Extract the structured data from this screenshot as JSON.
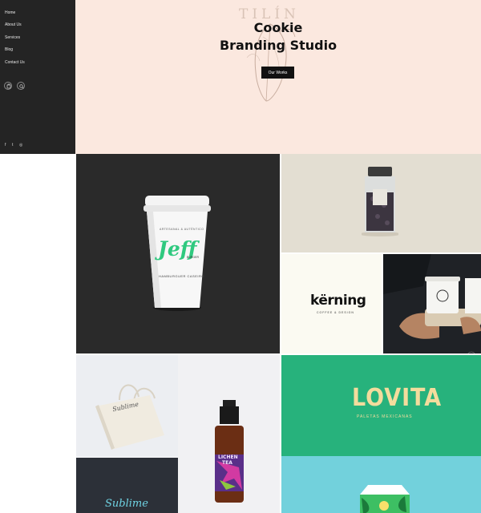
{
  "sidebar": {
    "nav": [
      {
        "label": "Home"
      },
      {
        "label": "About Us"
      },
      {
        "label": "Services"
      },
      {
        "label": "Blog"
      },
      {
        "label": "Contact Us"
      }
    ],
    "icons": [
      "cart-icon",
      "search-icon"
    ],
    "social": [
      {
        "icon": "facebook-icon",
        "glyph": "f"
      },
      {
        "icon": "twitter-icon",
        "glyph": "t"
      },
      {
        "icon": "instagram-icon",
        "glyph": "◎"
      }
    ]
  },
  "hero": {
    "watermark": "TILÍN",
    "title_line1": "Cookie",
    "title_line2": "Branding Studio",
    "cta_label": "Our Works"
  },
  "portfolio": {
    "cup": {
      "top_text": "ARTESANAL & AUTÉNTICO",
      "brand": "Jeff",
      "brand_sub": "BURGER",
      "bottom_text": "HAMBURGUER CASEIRO"
    },
    "kerning": {
      "brand": "kërning",
      "tagline": "COFFEE & DESIGN"
    },
    "lichen": {
      "brand_line1": "LICHEN",
      "brand_line2": "TEA"
    },
    "lovita": {
      "brand": "LOVITA",
      "tagline": "PALETAS MEXICANAS"
    },
    "sublime": {
      "brand": "Sublime"
    }
  },
  "colors": {
    "sidebar_bg": "#242424",
    "hero_bg": "#fbe8df",
    "lovita_green": "#27b27c",
    "teal_tile": "#72d1dc",
    "jeff_green": "#2fc97f"
  }
}
